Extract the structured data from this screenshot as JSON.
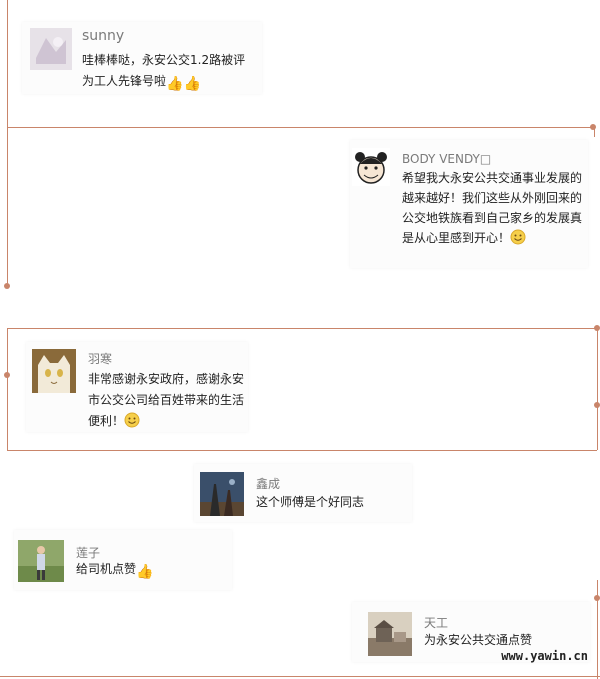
{
  "comments": [
    {
      "name": "sunny",
      "text": "哇棒棒哒，永安公交1.2路被评为工人先锋号啦",
      "emoji": [
        "thumbs-up-icon",
        "thumbs-up-icon"
      ]
    },
    {
      "name": "BODY VENDY□",
      "text": "希望我大永安公共交通事业发展的越来越好！我们这些从外刚回来的公交地铁族看到自己家乡的发展真是从心里感到开心！",
      "emoji": [
        "smile-icon"
      ]
    },
    {
      "name": "羽寒",
      "text": "非常感谢永安政府，感谢永安市公交公司给百姓带来的生活便利！",
      "emoji": [
        "smile-icon"
      ]
    },
    {
      "name": "鑫成",
      "text": "这个师傅是个好同志",
      "emoji": []
    },
    {
      "name": "莲子",
      "text": "给司机点赞",
      "emoji": [
        "thumbs-up-icon"
      ]
    },
    {
      "name": "天工",
      "text": "为永安公共交通点赞",
      "emoji": []
    }
  ],
  "watermark": "www.yawin.cn",
  "colors": {
    "rule": "#c9856a",
    "card": "#fcfcfc",
    "name": "#7a7a7a",
    "text": "#222222"
  }
}
